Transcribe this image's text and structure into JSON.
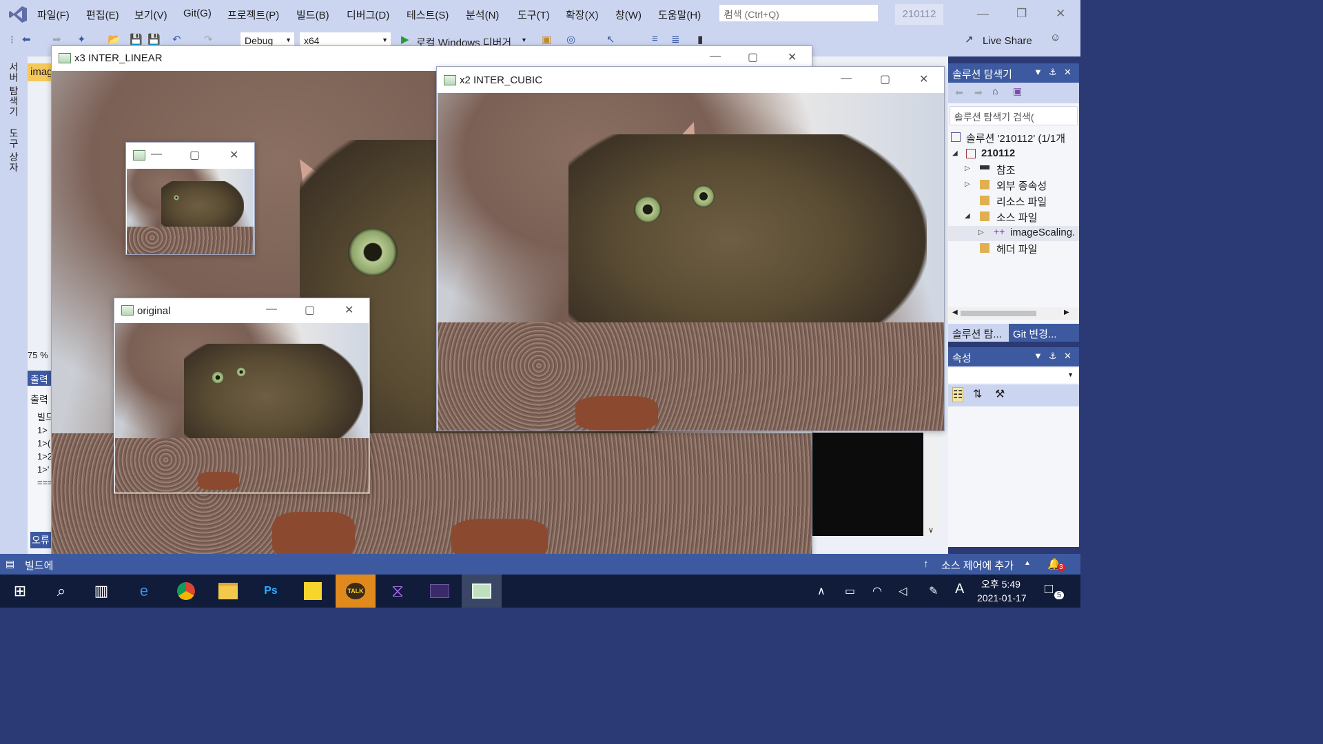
{
  "menubar": {
    "items": [
      "파일(F)",
      "편집(E)",
      "보기(V)",
      "Git(G)",
      "프로젝트(P)",
      "빌드(B)",
      "디버그(D)",
      "테스트(S)",
      "분석(N)",
      "도구(T)",
      "확장(X)",
      "창(W)",
      "도움말(H)"
    ],
    "search_placeholder": "검색 (Ctrl+Q)",
    "solution_badge": "210112"
  },
  "toolbar": {
    "config": "Debug",
    "platform": "x64",
    "debugger": "로컬 Windows 디버거",
    "live_share": "Live Share"
  },
  "left_strip": {
    "server_explorer": "서버 탐색기",
    "toolbox": "도구 상자"
  },
  "editor": {
    "tab_fragment": "imag",
    "zoom": "75 %",
    "output_title": "출력",
    "output_source": "출력",
    "output_lines": [
      "빌드",
      "1>",
      "1>(",
      "1>2",
      "1>'",
      "==="
    ],
    "error_tab": "오류"
  },
  "windows": {
    "x3": {
      "title": "x3 INTER_LINEAR"
    },
    "x2": {
      "title": "x2 INTER_CUBIC"
    },
    "small": {
      "title": ""
    },
    "original": {
      "title": "original"
    }
  },
  "solution_explorer": {
    "title": "솔루션 탐색기",
    "search_placeholder": "솔루션 탐색기 검색(",
    "tree": [
      {
        "label": "솔루션 '210112' (1/1개"
      },
      {
        "label": "210112"
      },
      {
        "label": "참조"
      },
      {
        "label": "외부 종속성"
      },
      {
        "label": "리소스 파일"
      },
      {
        "label": "소스 파일"
      },
      {
        "label": "imageScaling."
      },
      {
        "label": "헤더 파일"
      }
    ],
    "tabs": [
      "솔루션 탐...",
      "Git 변경..."
    ]
  },
  "properties": {
    "title": "속성"
  },
  "statusbar": {
    "left": "빌드에",
    "source_control": "소스 제어에 추가",
    "notifications": "3"
  },
  "taskbar": {
    "time": "오후 5:49",
    "date": "2021-01-17",
    "ime": "A",
    "notification_count": "5",
    "apps": [
      "start",
      "search",
      "task-view",
      "internet-explorer",
      "chrome",
      "file-explorer",
      "photoshop",
      "sticky-notes",
      "kakaotalk",
      "visual-studio",
      "terminal",
      "image-viewer"
    ]
  },
  "colors": {
    "accent": "#3d5aa0",
    "menubar": "#ccd5f0",
    "taskbar": "#101c3a"
  }
}
